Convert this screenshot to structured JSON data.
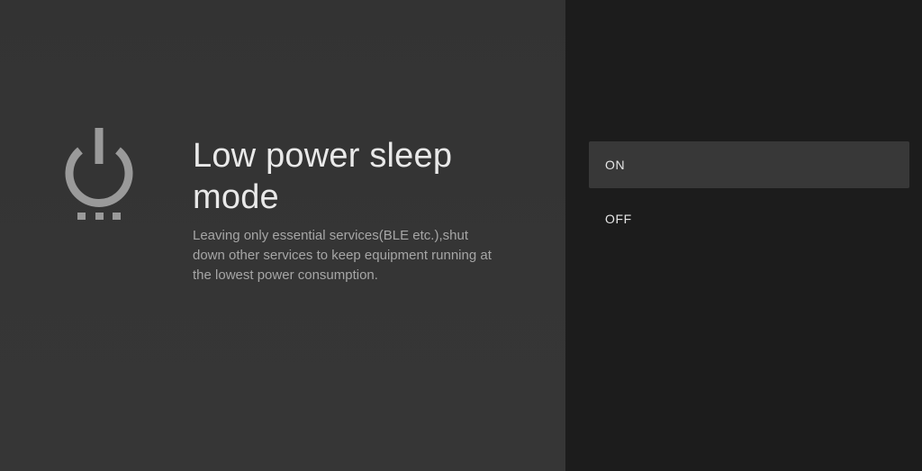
{
  "setting": {
    "title": "Low power sleep mode",
    "description": "Leaving only essential services(BLE etc.),shut down other services to keep equipment running at the lowest power consumption.",
    "icon": "power-sleep-icon"
  },
  "options": {
    "on_label": "ON",
    "off_label": "OFF",
    "focused": "ON"
  },
  "colors": {
    "left_panel": "#343434",
    "right_panel": "#1c1c1c",
    "focus_highlight": "#383838",
    "title_text": "#e9e9e9",
    "description_text": "#a6a6a6",
    "icon": "#9a9a9a"
  }
}
